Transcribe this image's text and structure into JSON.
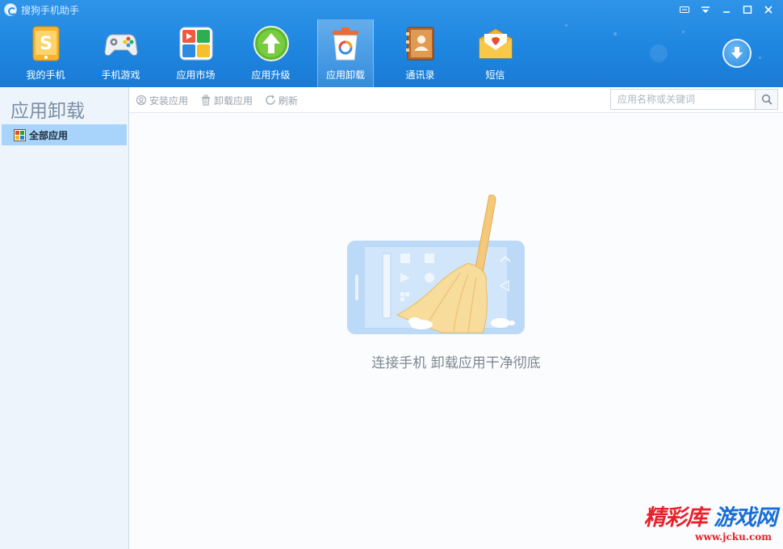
{
  "window": {
    "title": "搜狗手机助手",
    "controls": [
      "menu-icon",
      "dropdown-icon",
      "minimize-icon",
      "maximize-icon",
      "close-icon"
    ]
  },
  "nav": {
    "items": [
      {
        "label": "我的手机",
        "icon": "phone-icon"
      },
      {
        "label": "手机游戏",
        "icon": "gamepad-icon"
      },
      {
        "label": "应用市场",
        "icon": "app-market-icon"
      },
      {
        "label": "应用升级",
        "icon": "upgrade-arrow-icon"
      },
      {
        "label": "应用卸载",
        "icon": "trash-can-icon",
        "active": true
      },
      {
        "label": "通讯录",
        "icon": "contacts-book-icon"
      },
      {
        "label": "短信",
        "icon": "envelope-icon"
      }
    ],
    "download_icon": "download-arrow-icon"
  },
  "sidebar": {
    "title": "应用卸载",
    "items": [
      {
        "label": "全部应用",
        "icon": "grid-icon",
        "selected": true
      }
    ]
  },
  "toolbar": {
    "install_label": "安装应用",
    "uninstall_label": "卸载应用",
    "refresh_label": "刷新",
    "search_placeholder": "应用名称或关键词"
  },
  "main": {
    "empty_message": "连接手机 卸载应用干净彻底",
    "empty_illustration": "broom-sweeping-phone-icon"
  },
  "watermark": {
    "text_red": "精彩库",
    "text_blue": "游戏网",
    "url": "www.jcku.com"
  },
  "colors": {
    "topbar": "#1f86e0",
    "sidebar_bg": "#eef4fb",
    "sidebar_selected": "#a8d3fa",
    "watermark_red": "#e8202a",
    "watermark_blue": "#1a6fd6"
  }
}
